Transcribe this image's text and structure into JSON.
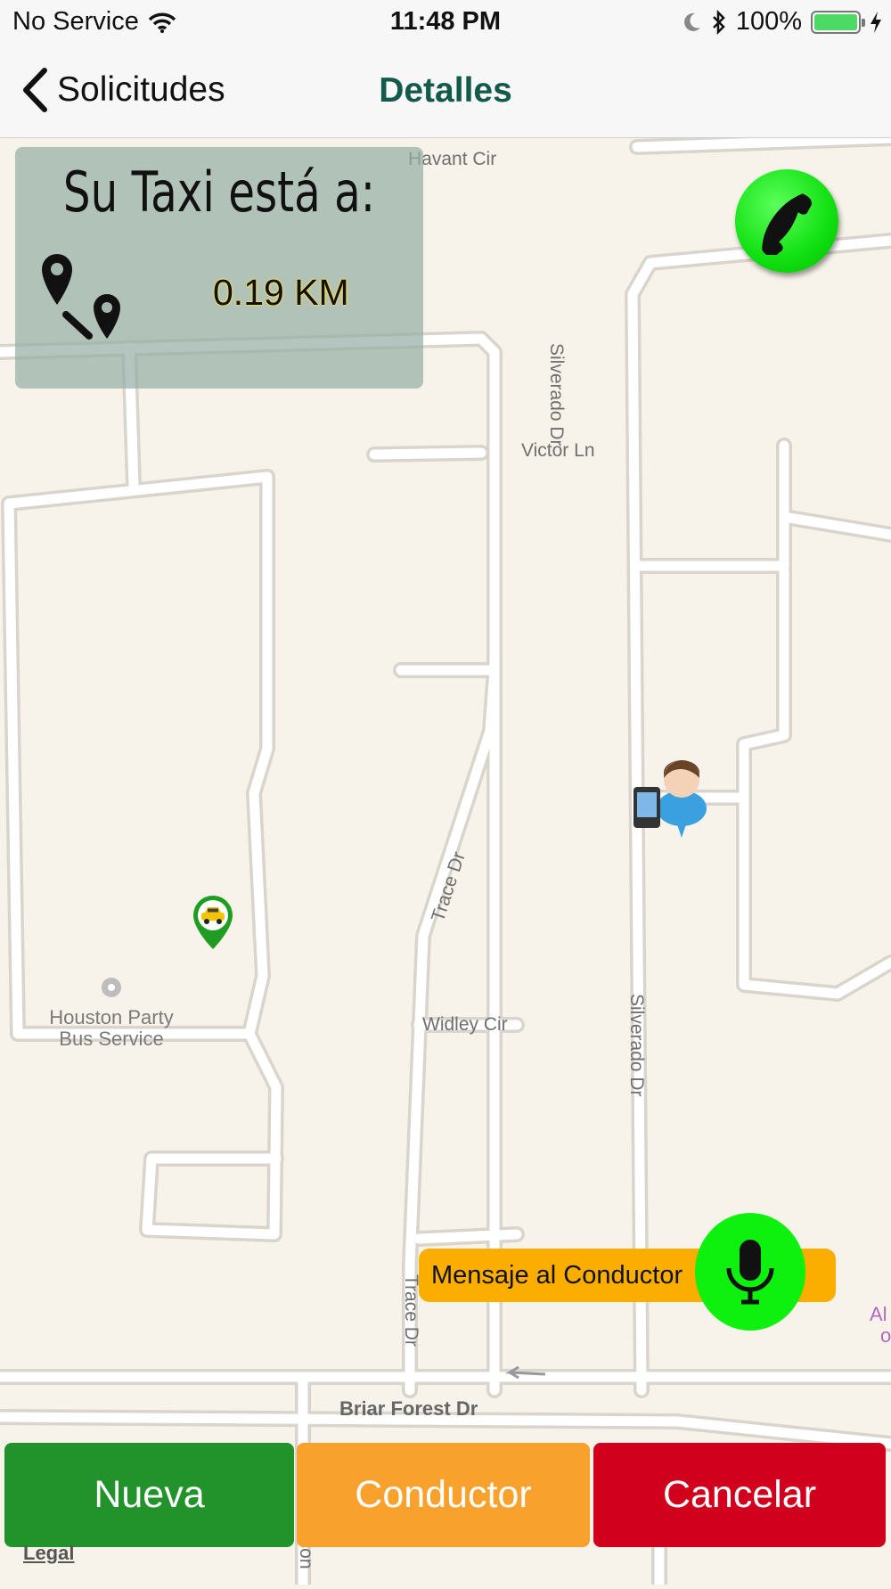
{
  "status_bar": {
    "carrier": "No Service",
    "time": "11:48 PM",
    "battery_percent": "100%",
    "battery_level": 1.0
  },
  "nav": {
    "back_label": "Solicitudes",
    "title": "Detalles"
  },
  "distance_panel": {
    "title": "Su Taxi está a:",
    "value": "0.19 KM"
  },
  "map": {
    "streets": {
      "havant": "Havant Cir",
      "victor": "Victor Ln",
      "silverado_1": "Silverado Dr",
      "silverado_2": "Silverado Dr",
      "trace_1": "Trace Dr",
      "trace_2": "Trace Dr",
      "widley": "Widley Cir",
      "briar": "Briar Forest Dr"
    },
    "poi": {
      "line1": "Houston Party",
      "line2": "Bus Service"
    },
    "edge_label": "Al",
    "edge_label2": "o",
    "legal": "Legal",
    "partial_street": "acon"
  },
  "message": {
    "label": "Mensaje al Conductor"
  },
  "buttons": {
    "nueva": "Nueva",
    "conductor": "Conductor",
    "cancelar": "Cancelar"
  },
  "colors": {
    "nueva": "#22932a",
    "conductor": "#f8a12c",
    "cancelar": "#d1001c",
    "call": "#10e010",
    "message": "#fbae00",
    "title": "#145a4a"
  }
}
